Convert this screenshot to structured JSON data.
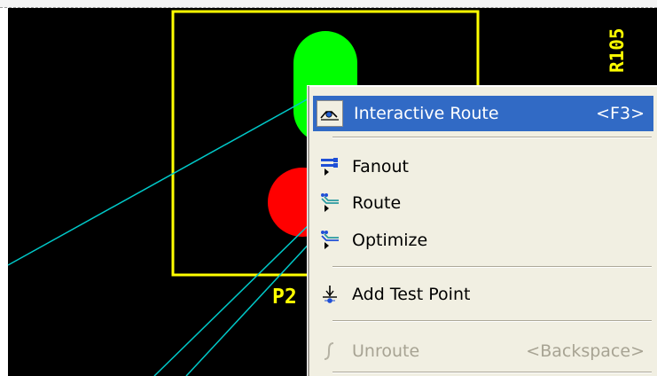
{
  "board": {
    "component_ref": "R105",
    "pin_label": "P2",
    "colors": {
      "background": "#000000",
      "outline": "#ffff00",
      "pad_top": "#00ff00",
      "pad_bottom": "#ff0000",
      "ratsnest": "#00c8c8"
    }
  },
  "menu": {
    "items": [
      {
        "label": "Interactive Route",
        "shortcut": "<F3>",
        "icon": "interactive-route-icon",
        "highlighted": true,
        "enabled": true
      },
      {
        "label": "Fanout",
        "shortcut": "",
        "icon": "fanout-icon",
        "highlighted": false,
        "enabled": true
      },
      {
        "label": "Route",
        "shortcut": "",
        "icon": "route-icon",
        "highlighted": false,
        "enabled": true
      },
      {
        "label": "Optimize",
        "shortcut": "",
        "icon": "optimize-icon",
        "highlighted": false,
        "enabled": true
      },
      {
        "label": "Add Test Point",
        "shortcut": "",
        "icon": "test-point-icon",
        "highlighted": false,
        "enabled": true
      },
      {
        "label": "Unroute",
        "shortcut": "<Backspace>",
        "icon": "unroute-icon",
        "highlighted": false,
        "enabled": false
      }
    ],
    "colors": {
      "background": "#f1efe2",
      "highlight": "#316ac5",
      "disabled_text": "#a7a393"
    }
  }
}
